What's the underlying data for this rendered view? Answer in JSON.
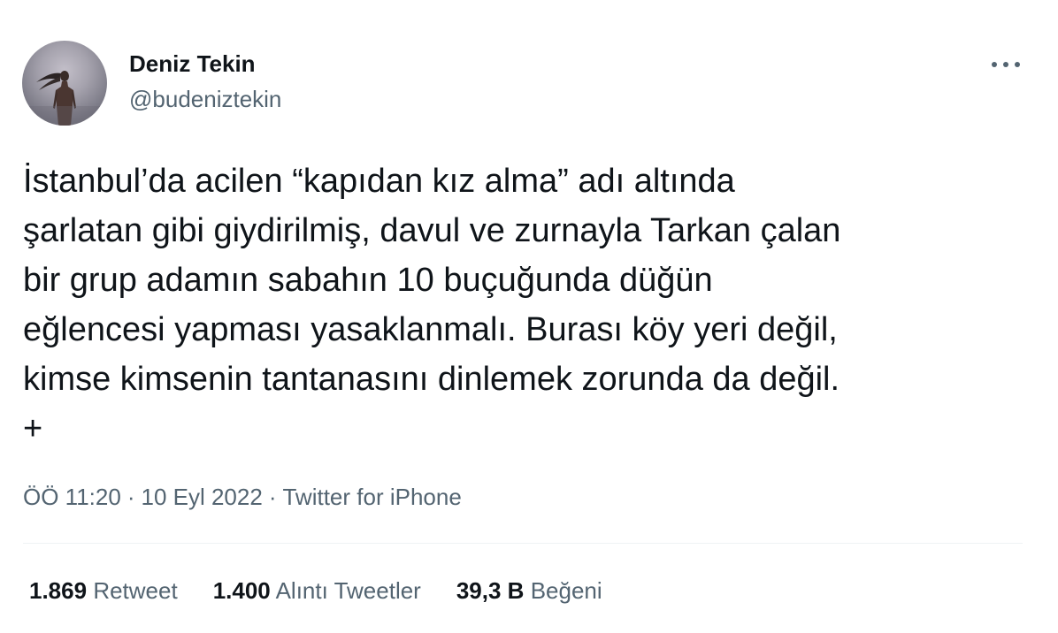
{
  "author": {
    "display_name": "Deniz Tekin",
    "handle": "@budeniztekin"
  },
  "tweet": {
    "text_lines": [
      "İstanbul’da acilen “kapıdan kız alma” adı altında",
      "şarlatan gibi giydirilmiş, davul ve zurnayla Tarkan çalan",
      "bir grup adamın sabahın 10 buçuğunda düğün",
      "eğlencesi yapması yasaklanmalı. Burası köy yeri değil,",
      "kimse kimsenin tantanasını dinlemek zorunda da değil.",
      "+"
    ]
  },
  "meta": {
    "time": "ÖÖ 11:20",
    "separator": "·",
    "date": "10 Eyl 2022",
    "source": "Twitter for iPhone"
  },
  "stats": [
    {
      "count": "1.869",
      "label": "Retweet"
    },
    {
      "count": "1.400",
      "label": "Alıntı Tweetler"
    },
    {
      "count": "39,3 B",
      "label": "Beğeni"
    }
  ],
  "icons": {
    "more": "more-horizontal-icon",
    "avatar": "profile-photo"
  },
  "colors": {
    "text_primary": "#0f1419",
    "text_secondary": "#536471",
    "divider": "#eff3f4",
    "background": "#ffffff"
  }
}
